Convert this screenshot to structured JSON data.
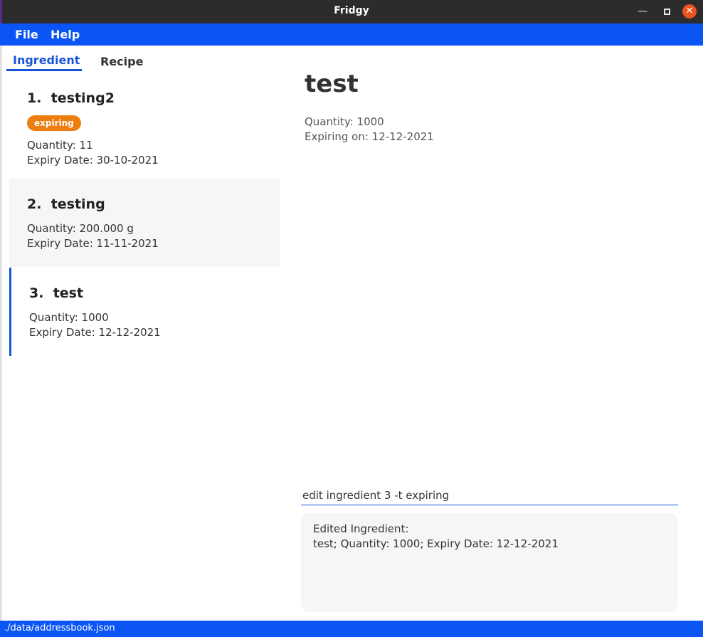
{
  "window": {
    "title": "Fridgy",
    "min_glyph": "—",
    "close_glyph": "✕"
  },
  "menu": {
    "file": "File",
    "help": "Help"
  },
  "tabs": [
    {
      "label": "Ingredient",
      "active": true
    },
    {
      "label": "Recipe",
      "active": false
    }
  ],
  "ingredients": [
    {
      "index": "1.",
      "name": "testing2",
      "tag": "expiring",
      "quantity": "Quantity: 11",
      "expiry": "Expiry Date: 30-10-2021"
    },
    {
      "index": "2.",
      "name": "testing",
      "quantity": "Quantity: 200.000 g",
      "expiry": "Expiry Date: 11-11-2021"
    },
    {
      "index": "3.",
      "name": "test",
      "quantity": "Quantity: 1000",
      "expiry": "Expiry Date: 12-12-2021"
    }
  ],
  "detail": {
    "name": "test",
    "quantity": "Quantity: 1000",
    "expiry": "Expiring on: 12-12-2021"
  },
  "command": {
    "value": "edit ingredient 3 -t expiring"
  },
  "result": {
    "line1": "Edited Ingredient:",
    "line2": "test; Quantity: 1000; Expiry Date: 12-12-2021"
  },
  "status": {
    "path": "./data/addressbook.json"
  },
  "colors": {
    "accent": "#0b55f5",
    "tag": "#ee7d0f",
    "titlebar": "#2c2c2c",
    "close": "#e95420"
  },
  "icons": {
    "minimize": "minimize-icon",
    "maximize": "maximize-icon",
    "close": "close-icon"
  }
}
